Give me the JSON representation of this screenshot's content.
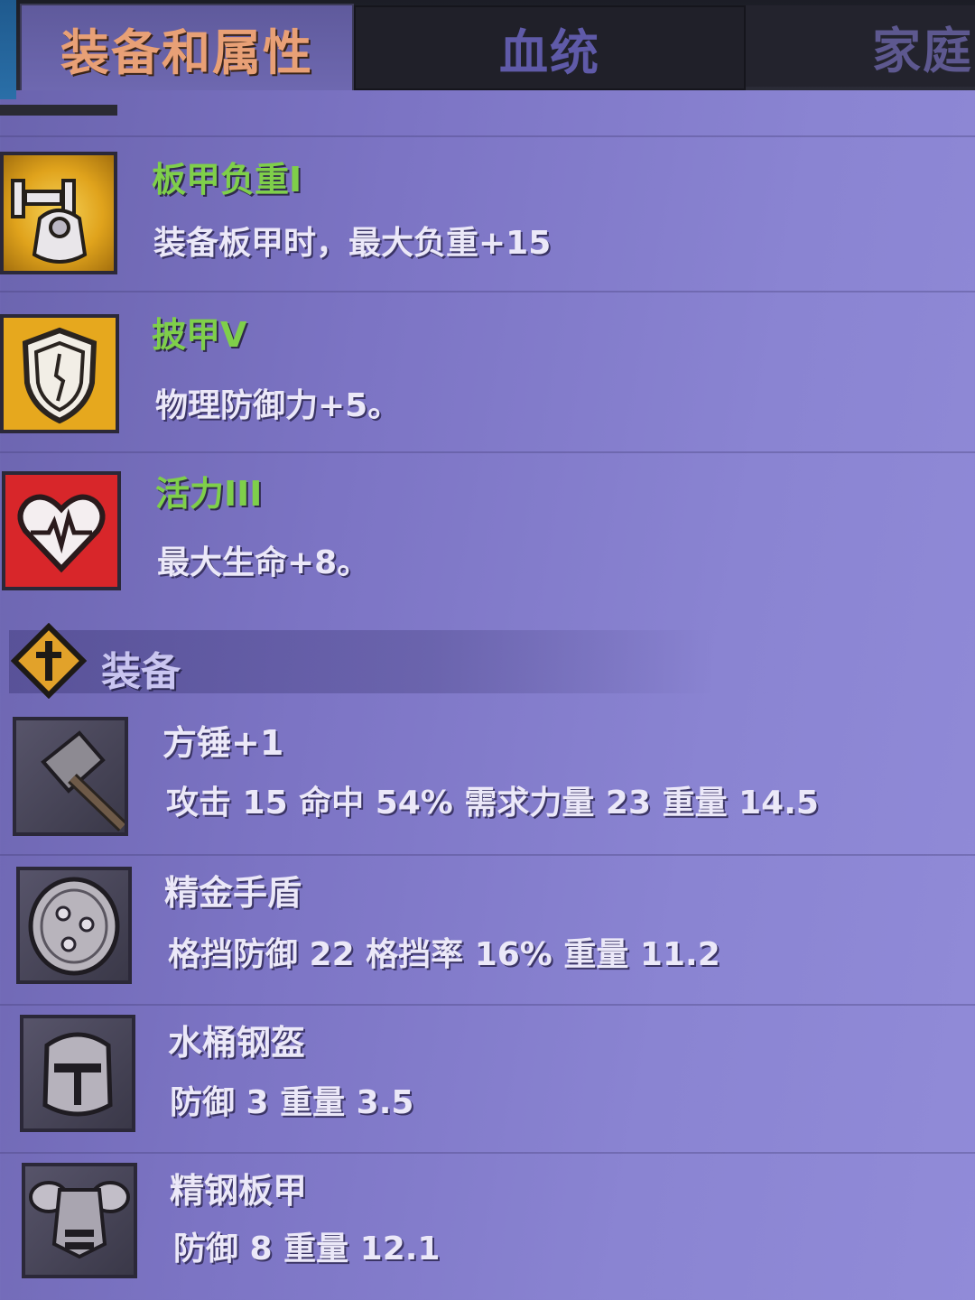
{
  "tabs": [
    {
      "label": "装备和属性",
      "active": true
    },
    {
      "label": "血统",
      "active": false
    },
    {
      "label": "家庭",
      "active": false
    }
  ],
  "perks": [
    {
      "name": "板甲负重I",
      "desc": "装备板甲时，最大负重+15",
      "icon": "plate-armor-weight-icon",
      "icon_bg": "#e0a31c"
    },
    {
      "name": "披甲V",
      "desc": "物理防御力+5。",
      "icon": "shield-icon",
      "icon_bg": "#e6a81e"
    },
    {
      "name": "活力III",
      "desc": "最大生命+8。",
      "icon": "heart-pulse-icon",
      "icon_bg": "#d8262a"
    }
  ],
  "section": {
    "label": "装备",
    "icon": "cross-diamond-icon"
  },
  "items": [
    {
      "name": "方锤+1",
      "stats": "攻击 15 命中 54% 需求力量 23 重量 14.5",
      "icon": "hammer-icon"
    },
    {
      "name": "精金手盾",
      "stats": "格挡防御 22 格挡率 16% 重量 11.2",
      "icon": "round-shield-icon"
    },
    {
      "name": "水桶钢盔",
      "stats": "防御 3 重量 3.5",
      "icon": "bucket-helmet-icon"
    },
    {
      "name": "精钢板甲",
      "stats": "防御 8 重量 12.1",
      "icon": "steel-plate-armor-icon"
    }
  ],
  "colors": {
    "perk_name": "#7fcf4a",
    "active_tab": "#e8a076",
    "text": "#ebe8f8"
  }
}
